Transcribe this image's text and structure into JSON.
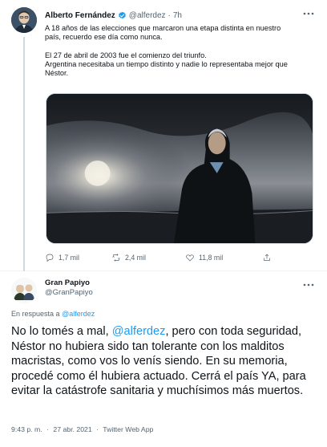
{
  "tweet_main": {
    "author_name": "Alberto Fernández",
    "author_handle": "@alferdez",
    "separator": "·",
    "time_ago": "7h",
    "text_lines": [
      "A 18 años de las elecciones que marcaron una etapa distinta en nuestro",
      "país, recuerdo ese día como nunca.",
      "El 27 de abril de 2003 fue el comienzo del triunfo.",
      "Argentina necesitaba un tiempo distinto y nadie lo representaba mejor que",
      "Néstor."
    ],
    "actions": {
      "replies": "1,7 mil",
      "retweets": "2,4 mil",
      "likes": "11,8 mil"
    }
  },
  "tweet_reply": {
    "author_name": "Gran Papiyo",
    "author_handle": "@GranPapiyo",
    "reply_prefix": "En respuesta a",
    "reply_to_handle": "@alferdez",
    "text_before_mention": "No lo tomés a mal, ",
    "mention": "@alferdez",
    "text_after_mention": ", pero con toda seguridad, Néstor no hubiera sido tan tolerante con los malditos macristas, como vos lo venís siendo. En su memoria, procedé como él hubiera actuado. Cerrá el país YA, para evitar la catástrofe sanitaria y muchísimos más muertos.",
    "time": "9:43 p. m.",
    "separator": "·",
    "date": "27 abr. 2021",
    "source": "Twitter Web App"
  },
  "colors": {
    "accent": "#1d9bf0",
    "muted": "#536471",
    "text": "#0f1419",
    "divider": "#eff3f4"
  },
  "icons": {
    "verified": "verified-badge-icon",
    "more": "more-dots-icon",
    "reply": "reply-icon",
    "retweet": "retweet-icon",
    "like": "heart-icon",
    "share": "share-icon"
  }
}
